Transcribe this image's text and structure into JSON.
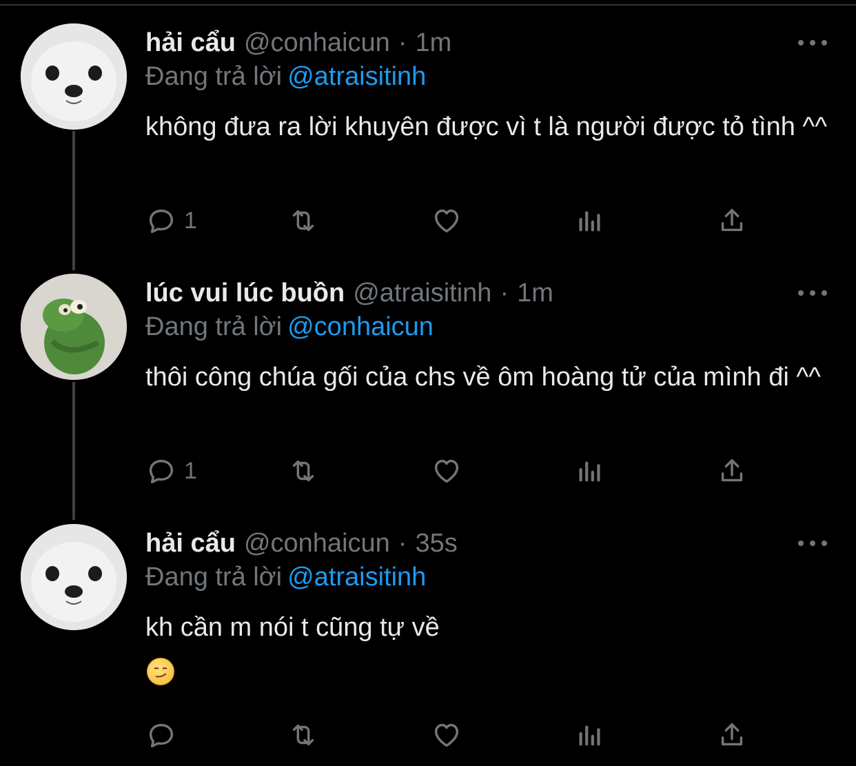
{
  "tweets": [
    {
      "name": "hải cẩu",
      "handle": "@conhaicun",
      "time": "1m",
      "reply_prefix": "Đang trả lời",
      "reply_to": "@atraisitinh",
      "text": "không đưa ra lời khuyên được vì t là người được tỏ tình ^^",
      "reply_count": "1",
      "avatar": "seal-avatar"
    },
    {
      "name": "lúc vui lúc buồn",
      "handle": "@atraisitinh",
      "time": "1m",
      "reply_prefix": "Đang trả lời",
      "reply_to": "@conhaicun",
      "text": "thôi công chúa gối của chs về ôm hoàng tử của mình đi ^^",
      "reply_count": "1",
      "avatar": "green-frog-avatar"
    },
    {
      "name": "hải cẩu",
      "handle": "@conhaicun",
      "time": "35s",
      "reply_prefix": "Đang trả lời",
      "reply_to": "@atraisitinh",
      "text": "kh cần m nói t cũng tự về",
      "emoji": "smirking-face-emoji",
      "avatar": "seal-avatar"
    }
  ],
  "separator": "·",
  "icons": [
    "reply-icon",
    "retweet-icon",
    "like-icon",
    "analytics-icon",
    "share-icon",
    "more-icon"
  ],
  "colors": {
    "background": "#000000",
    "text": "#e7e9ea",
    "muted": "#71767b",
    "mention": "#1d9bf0"
  }
}
